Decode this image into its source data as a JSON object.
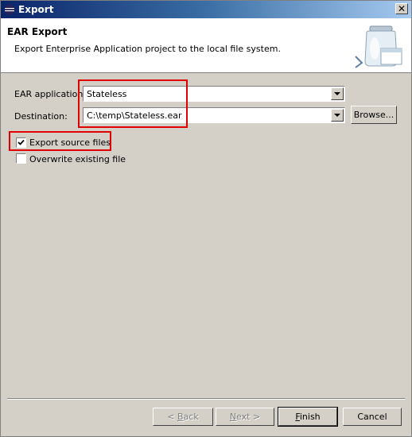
{
  "window": {
    "title": "Export",
    "close_label": "✕"
  },
  "header": {
    "title": "EAR Export",
    "description": "Export Enterprise Application project to the local file system."
  },
  "form": {
    "ear_label": "EAR application:",
    "ear_value": "Stateless",
    "dest_label": "Destination:",
    "dest_value": "C:\\temp\\Stateless.ear",
    "browse_label": "Browse...",
    "export_source_label": "Export source files",
    "export_source_checked": true,
    "overwrite_label": "Overwrite existing file",
    "overwrite_checked": false
  },
  "buttons": {
    "back_prefix": "< ",
    "back_mn": "B",
    "back_rest": "ack",
    "next_mn": "N",
    "next_rest": "ext >",
    "finish_mn": "F",
    "finish_rest": "inish",
    "cancel_label": "Cancel"
  },
  "icons": {
    "app": "eclipse-icon",
    "banner": "jar-export-icon",
    "dropdown": "chevron-down-icon",
    "check": "checkmark-icon"
  },
  "colors": {
    "highlight": "#e00000",
    "titlebar": "#0a246a"
  }
}
